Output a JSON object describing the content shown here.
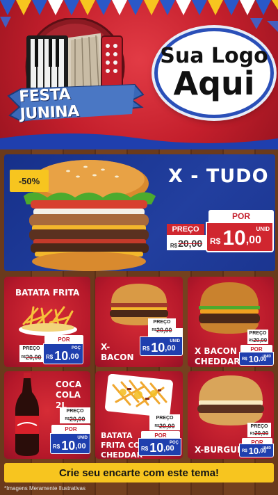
{
  "header": {
    "festival_banner": "FESTA JUNINA",
    "logo_line1": "Sua Logo",
    "logo_line2": "Aqui"
  },
  "colors": {
    "red": "#c41f2c",
    "blue": "#1f3fae",
    "yellow": "#f7c51f",
    "wood": "#6a3a1c"
  },
  "hero": {
    "badge": "-50%",
    "title": "X - TUDO",
    "por": "POR",
    "preco": "PREÇO",
    "old_currency": "R$",
    "old_price": "20,00",
    "currency": "R$",
    "price_int": "10",
    "price_dec": ",00",
    "unit": "UNID"
  },
  "products": [
    {
      "name": "BATATA FRITA",
      "preco": "PREÇO",
      "old_currency": "R$",
      "old_price": "20,00",
      "por": "POR",
      "currency": "R$",
      "price_int": "10",
      "price_dec": ",00",
      "unit": "POÇ",
      "icon": "fries-icon"
    },
    {
      "name": "X-\nBACON",
      "preco": "PREÇO",
      "old_currency": "R$",
      "old_price": "20,00",
      "por": "POR",
      "currency": "R$",
      "price_int": "10",
      "price_dec": ",00",
      "unit": "UNID",
      "icon": "burger-icon"
    },
    {
      "name": "X BACON E\nCHEDDAR",
      "preco": "PREÇO",
      "old_currency": "R$",
      "old_price": "20,00",
      "por": "POR",
      "currency": "R$",
      "price_int": "10",
      "price_dec": ",00",
      "unit": "UNID",
      "icon": "burger-icon"
    },
    {
      "name": "COCA\nCOLA 2L",
      "preco": "PREÇO",
      "old_currency": "R$",
      "old_price": "20,00",
      "por": "POR",
      "currency": "R$",
      "price_int": "10",
      "price_dec": ",00",
      "unit": "UNID",
      "icon": "soda-bottle-icon"
    },
    {
      "name": "BATATA\nFRITA COM\nCHEDDAR",
      "preco": "PREÇO",
      "old_currency": "R$",
      "old_price": "20,00",
      "por": "POR",
      "currency": "R$",
      "price_int": "10",
      "price_dec": ",00",
      "unit": "POÇ",
      "icon": "cheese-fries-icon"
    },
    {
      "name": "X-BURGUER",
      "preco": "PREÇO",
      "old_currency": "R$",
      "old_price": "20,00",
      "por": "POR",
      "currency": "R$",
      "price_int": "10",
      "price_dec": ",00",
      "unit": "UNID",
      "icon": "burger-icon"
    }
  ],
  "footer": {
    "cta": "Crie seu encarte com este tema!",
    "disclaimer": "*Imagens Meramente Ilustrativas"
  }
}
